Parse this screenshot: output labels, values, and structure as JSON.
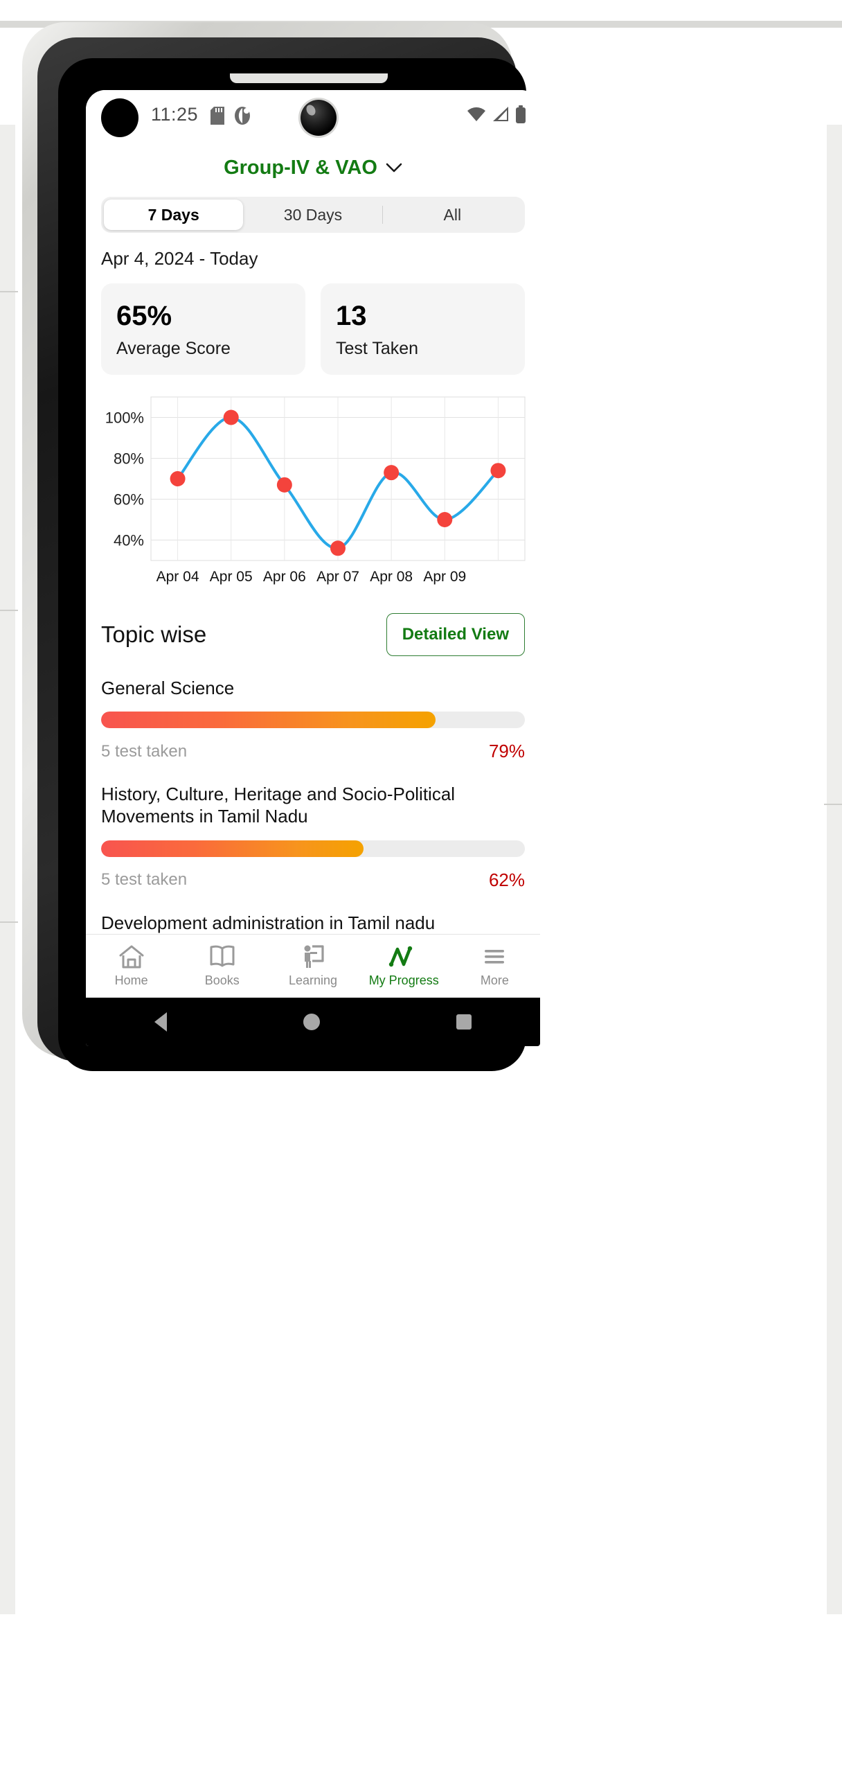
{
  "status_bar": {
    "time": "11:25",
    "icons": [
      "sd-card-icon",
      "dnd-icon",
      "wifi-icon",
      "signal-icon",
      "battery-icon"
    ]
  },
  "header": {
    "title": "Group-IV & VAO",
    "dropdown_glyph": "⌄",
    "title_color": "#137b13"
  },
  "tabs": [
    {
      "label": "7 Days",
      "active": true
    },
    {
      "label": "30 Days",
      "active": false
    },
    {
      "label": "All",
      "active": false
    }
  ],
  "date_range": "Apr 4, 2024 - Today",
  "stat_cards": [
    {
      "value": "65%",
      "label": "Average Score"
    },
    {
      "value": "13",
      "label": "Test Taken"
    }
  ],
  "chart_data": {
    "type": "line",
    "title": "",
    "xlabel": "",
    "ylabel": "",
    "x": [
      "Apr 04",
      "Apr 05",
      "Apr 06",
      "Apr 07",
      "Apr 08",
      "Apr 09"
    ],
    "categories": [
      "Apr 04",
      "Apr 05",
      "Apr 06",
      "Apr 07",
      "Apr 08",
      "Apr 09"
    ],
    "values": [
      70,
      100,
      67,
      36,
      73,
      50,
      74
    ],
    "series": [
      {
        "name": "Score",
        "values": [
          70,
          100,
          67,
          36,
          73,
          50,
          74
        ]
      }
    ],
    "ytick_labels": [
      "40%",
      "60%",
      "80%",
      "100%"
    ],
    "yticks": [
      40,
      60,
      80,
      100
    ],
    "ylim": [
      30,
      110
    ],
    "grid": true,
    "legend": "none",
    "line_color": "#28a9e8",
    "point_color": "#f4433c"
  },
  "topic_section": {
    "heading": "Topic wise",
    "detailed_view_label": "Detailed View",
    "items": [
      {
        "name": "General Science",
        "tests": "5 test taken",
        "percent_label": "79%",
        "percent": 79
      },
      {
        "name": "History, Culture, Heritage and Socio-Political Movements in Tamil Nadu",
        "tests": "5 test taken",
        "percent_label": "62%",
        "percent": 62
      },
      {
        "name": "Development administration in Tamil nadu",
        "tests": "",
        "percent_label": "",
        "percent": 0
      }
    ]
  },
  "bottom_nav": [
    {
      "label": "Home",
      "icon": "home-icon",
      "active": false
    },
    {
      "label": "Books",
      "icon": "book-icon",
      "active": false
    },
    {
      "label": "Learning",
      "icon": "learning-icon",
      "active": false
    },
    {
      "label": "My Progress",
      "icon": "progress-icon",
      "active": true
    },
    {
      "label": "More",
      "icon": "hamburger-icon",
      "active": false
    }
  ],
  "android_nav": [
    "back-button",
    "home-button",
    "recents-button"
  ]
}
